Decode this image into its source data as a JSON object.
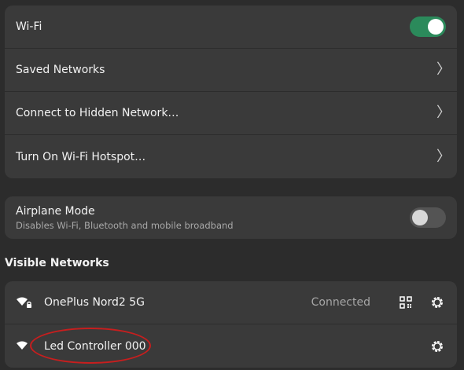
{
  "wifi_card": {
    "wifi_label": "Wi-Fi",
    "wifi_enabled": true,
    "saved_networks_label": "Saved Networks",
    "hidden_network_label": "Connect to Hidden Network…",
    "hotspot_label": "Turn On Wi-Fi Hotspot…",
    "chevron": "〉"
  },
  "airplane_card": {
    "label": "Airplane Mode",
    "subtitle": "Disables Wi-Fi, Bluetooth and mobile broadband",
    "enabled": false
  },
  "visible_networks": {
    "title": "Visible Networks",
    "networks": [
      {
        "name": "OnePlus Nord2 5G",
        "status": "Connected",
        "secured": true,
        "icons": [
          "wifi-lock-icon",
          "qr-code-icon",
          "gear-icon"
        ]
      },
      {
        "name": "Led Controller 000",
        "status": "",
        "secured": false,
        "icons": [
          "wifi-icon",
          "gear-icon"
        ]
      }
    ]
  },
  "colors": {
    "background": "#2c2c2c",
    "card": "#3a3a3a",
    "switch_on": "#2b8a5b",
    "highlight": "#c81e1e"
  }
}
